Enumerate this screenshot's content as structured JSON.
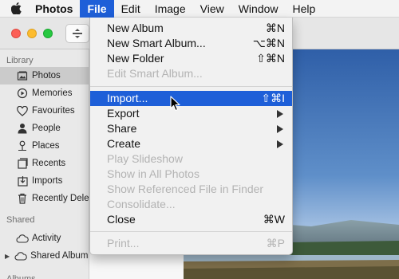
{
  "menubar": {
    "apple_icon": "apple-icon",
    "app": "Photos",
    "items": [
      "File",
      "Edit",
      "Image",
      "View",
      "Window",
      "Help"
    ],
    "active": "File"
  },
  "sidebar": {
    "library_header": "Library",
    "library_items": [
      {
        "label": "Photos",
        "icon": "photos-icon",
        "selected": true
      },
      {
        "label": "Memories",
        "icon": "memories-icon"
      },
      {
        "label": "Favourites",
        "icon": "heart-icon"
      },
      {
        "label": "People",
        "icon": "person-icon"
      },
      {
        "label": "Places",
        "icon": "pin-icon"
      },
      {
        "label": "Recents",
        "icon": "recents-icon"
      },
      {
        "label": "Imports",
        "icon": "imports-icon"
      },
      {
        "label": "Recently Delet",
        "icon": "trash-icon"
      }
    ],
    "shared_header": "Shared",
    "shared_items": [
      {
        "label": "Activity",
        "icon": "cloud-icon"
      },
      {
        "label": "Shared Albums",
        "icon": "cloud-icon"
      }
    ],
    "albums_header": "Albums"
  },
  "file_menu": {
    "new_album": {
      "label": "New Album",
      "shortcut": "⌘N"
    },
    "new_smart_album": {
      "label": "New Smart Album...",
      "shortcut": "⌥⌘N"
    },
    "new_folder": {
      "label": "New Folder",
      "shortcut": "⇧⌘N"
    },
    "edit_smart_album": {
      "label": "Edit Smart Album..."
    },
    "import": {
      "label": "Import...",
      "shortcut": "⇧⌘I"
    },
    "export": {
      "label": "Export"
    },
    "share": {
      "label": "Share"
    },
    "create": {
      "label": "Create"
    },
    "play_slideshow": {
      "label": "Play Slideshow"
    },
    "show_in_all_photos": {
      "label": "Show in All Photos"
    },
    "show_referenced_file": {
      "label": "Show Referenced File in Finder"
    },
    "consolidate": {
      "label": "Consolidate..."
    },
    "close": {
      "label": "Close",
      "shortcut": "⌘W"
    },
    "print": {
      "label": "Print...",
      "shortcut": "⌘P"
    }
  },
  "colors": {
    "accent": "#1e5fd8"
  }
}
